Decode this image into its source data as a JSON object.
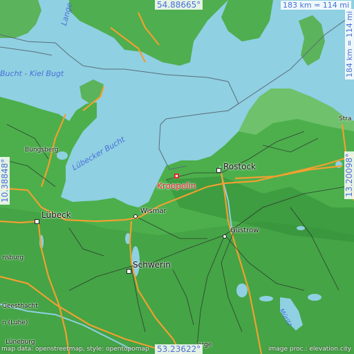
{
  "map": {
    "highlight_city": "Kroepelin",
    "coords": {
      "north": "54.88665°",
      "south": "53.23622°",
      "west": "10.38848°",
      "east": "13.20098°"
    },
    "scale_h": "183 km = 114 mi",
    "scale_v": "184 km = 114 mi",
    "water_labels": {
      "kiel_bay": "Bucht - Kiel Bugt",
      "luebeck_bay": "Lübecker Bucht",
      "langeland": "Lange"
    },
    "cities": {
      "rostock": "Rostock",
      "luebeck": "Lübeck",
      "schwerin": "Schwerin",
      "wismar": "Wismar",
      "guestrow": "Güstrow",
      "bungsberg": "Bungsberg",
      "geesthacht": "Geesthacht",
      "luneburg": "Lüneburg",
      "insburg": "nsburg",
      "luhe": "n (Luhe)",
      "stra": "Stra",
      "mueritz": "Müritz",
      "berge": "erge"
    },
    "credit_left": "map data: openstreetmap, style: opentopomap",
    "credit_right": "image proc.: elevation.city",
    "colors": {
      "sea": "#8fd0e2",
      "land": "#4caf4c",
      "highlight": "#e8262e",
      "label_blue": "#4a6fd8"
    }
  }
}
